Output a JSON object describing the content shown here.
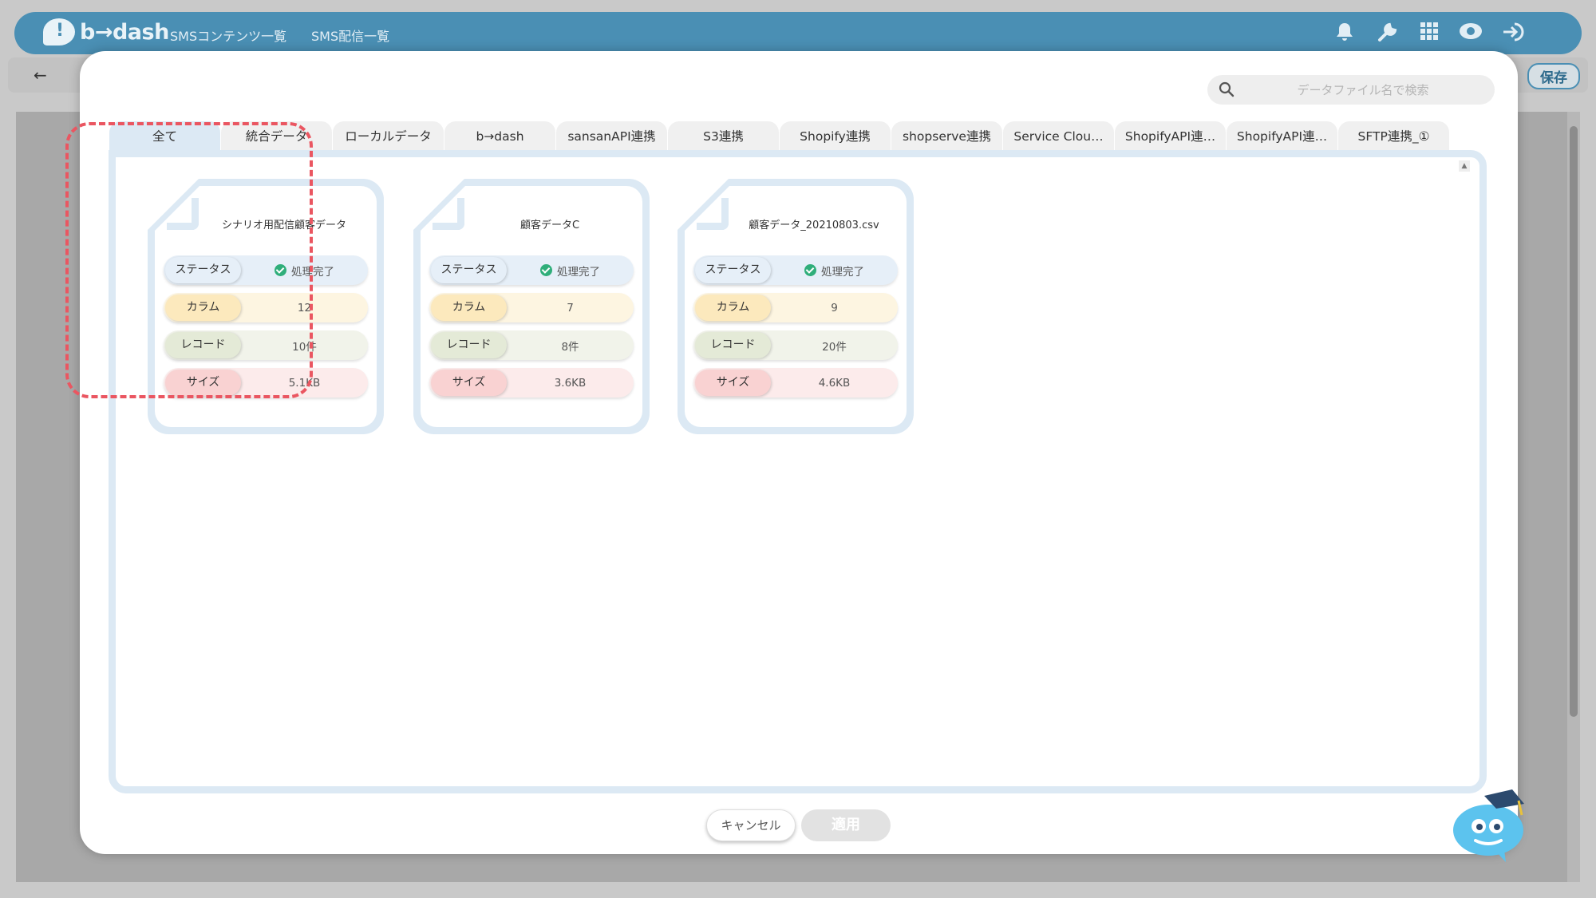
{
  "app": {
    "logo_text": "b→dash",
    "nav": [
      "SMSコンテンツ一覧",
      "SMS配信一覧"
    ],
    "subbar_save_label": "保存",
    "subbar_back_label": "←"
  },
  "search": {
    "placeholder": "データファイル名で検索"
  },
  "tabs": [
    {
      "label": "全て",
      "active": true
    },
    {
      "label": "統合データ"
    },
    {
      "label": "ローカルデータ"
    },
    {
      "label": "b→dash"
    },
    {
      "label": "sansanAPI連携"
    },
    {
      "label": "S3連携"
    },
    {
      "label": "Shopify連携"
    },
    {
      "label": "shopserve連携"
    },
    {
      "label": "Service Clou…"
    },
    {
      "label": "ShopifyAPI連…"
    },
    {
      "label": "ShopifyAPI連…"
    },
    {
      "label": "SFTP連携_①"
    }
  ],
  "labels": {
    "status": "ステータス",
    "column": "カラム",
    "record": "レコード",
    "size": "サイズ"
  },
  "cards": [
    {
      "title": "シナリオ用配信顧客データ",
      "status": "処理完了",
      "columns": "12",
      "records": "10件",
      "size": "5.1KB",
      "selected": true
    },
    {
      "title": "顧客データC",
      "status": "処理完了",
      "columns": "7",
      "records": "8件",
      "size": "3.6KB"
    },
    {
      "title": "顧客データ_20210803.csv",
      "status": "処理完了",
      "columns": "9",
      "records": "20件",
      "size": "4.6KB"
    }
  ],
  "footer": {
    "cancel_label": "キャンセル",
    "apply_label": "適用"
  },
  "colors": {
    "brand": "#4a8fb4",
    "panel_border": "#dce9f4",
    "highlight": "#ea5661",
    "status_ok": "#2fae7a"
  }
}
